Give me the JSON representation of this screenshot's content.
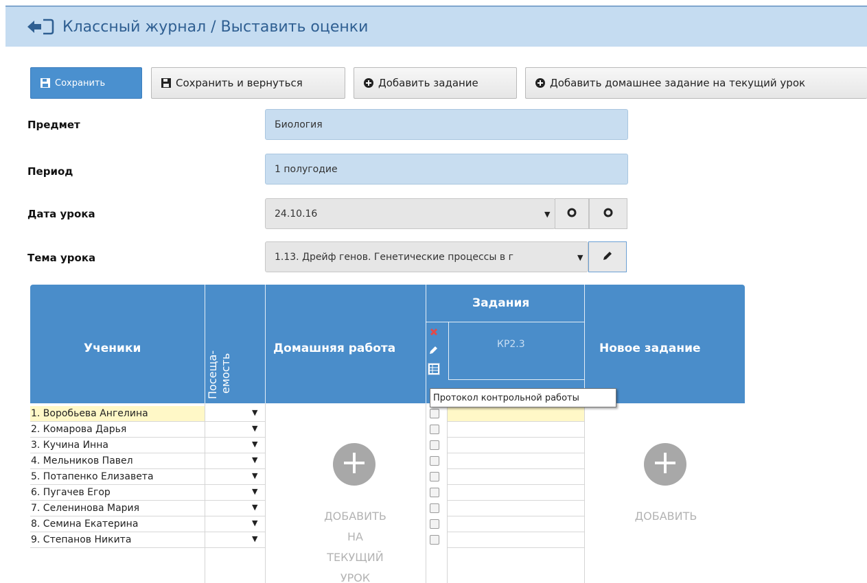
{
  "header": {
    "title": "Классный журнал / Выставить оценки"
  },
  "toolbar": {
    "save": "Сохранить",
    "save_return": "Сохранить и вернуться",
    "add_task": "Добавить задание",
    "add_homework": "Добавить домашнее задание на текущий урок"
  },
  "form": {
    "subject_label": "Предмет",
    "subject_value": "Биология",
    "period_label": "Период",
    "period_value": "1 полугодие",
    "date_label": "Дата урока",
    "date_value": "24.10.16",
    "topic_label": "Тема урока",
    "topic_value": "1.13. Дрейф генов. Генетические процессы в г"
  },
  "table": {
    "col_students": "Ученики",
    "col_attendance_1": "Посеща-",
    "col_attendance_2": "емость",
    "col_homework": "Домашняя работа",
    "col_tasks": "Задания",
    "task_name": "КР2.3",
    "col_new_task": "Новое задание",
    "students": [
      "1. Воробьева Ангелина",
      "2. Комарова Дарья",
      "3. Кучина Инна",
      "4. Мельников Павел",
      "5. Потапенко Елизавета",
      "6. Пугачев Егор",
      "7. Селенинова Мария",
      "8. Семина Екатерина",
      "9. Степанов Никита"
    ],
    "homework_add_1": "ДОБАВИТЬ",
    "homework_add_2": "НА",
    "homework_add_3": "ТЕКУЩИЙ",
    "homework_add_4": "УРОК",
    "new_task_add": "ДОБАВИТЬ"
  },
  "tooltip": "Протокол контрольной работы",
  "colors": {
    "header_bg": "#c5dcf1",
    "table_header": "#4a8dca",
    "primary_button": "#4a90cf",
    "highlight_row": "#fff8c7"
  },
  "icons": [
    "back-arrow-icon",
    "floppy-icon",
    "plus-circle-icon",
    "pencil-icon",
    "delete-x-icon",
    "table-icon",
    "add-circle-icon"
  ]
}
